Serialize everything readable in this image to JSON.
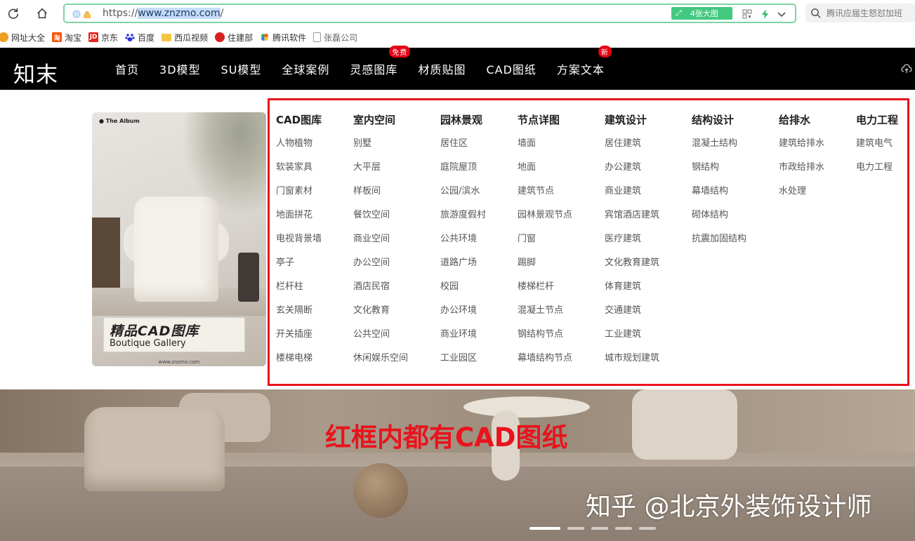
{
  "browser": {
    "url_prefix": "https://",
    "url_host": "www.znzmo.com",
    "url_suffix": "/",
    "bigimg_label": "4张大图",
    "search_placeholder": "腾讯应届生怒怼加班"
  },
  "bookmarks": [
    {
      "label": "网址大全",
      "icon": "globe-icon",
      "color": "#f0a020"
    },
    {
      "label": "淘宝",
      "icon": "taobao-icon",
      "color": "#ff5000"
    },
    {
      "label": "京东",
      "icon": "jd-icon",
      "color": "#e1251b"
    },
    {
      "label": "百度",
      "icon": "baidu-icon",
      "color": "#2932e1"
    },
    {
      "label": "西瓜视频",
      "icon": "folder-icon",
      "color": "#f5c542"
    },
    {
      "label": "住建部",
      "icon": "emblem-icon",
      "color": "#d82020"
    },
    {
      "label": "腾讯软件",
      "icon": "tencent-icon",
      "color": "#3cb44b"
    },
    {
      "label": "张磊公司",
      "icon": "document-icon",
      "color": "#999999"
    }
  ],
  "site": {
    "logo": "知末",
    "nav": [
      {
        "label": "首页"
      },
      {
        "label": "3D模型"
      },
      {
        "label": "SU模型"
      },
      {
        "label": "全球案例"
      },
      {
        "label": "灵感图库",
        "badge": "免费"
      },
      {
        "label": "材质贴图"
      },
      {
        "label": "CAD图纸"
      },
      {
        "label": "方案文本",
        "badge": "新"
      }
    ]
  },
  "album": {
    "tag": "● The Album",
    "title_cn": "精品CAD图库",
    "title_en": "Boutique Gallery",
    "url": "www.znzmo.com"
  },
  "categories": [
    {
      "title": "CAD图库",
      "items": [
        "人物植物",
        "软装家具",
        "门窗素材",
        "地面拼花",
        "电视背景墙",
        "亭子",
        "栏杆柱",
        "玄关隔断",
        "开关插座",
        "楼梯电梯"
      ]
    },
    {
      "title": "室内空间",
      "items": [
        "别墅",
        "大平层",
        "样板间",
        "餐饮空间",
        "商业空间",
        "办公空间",
        "酒店民宿",
        "文化教育",
        "公共空间",
        "休闲娱乐空间"
      ]
    },
    {
      "title": "园林景观",
      "items": [
        "居住区",
        "庭院屋顶",
        "公园/滨水",
        "旅游度假村",
        "公共环境",
        "道路广场",
        "校园",
        "办公环境",
        "商业环境",
        "工业园区"
      ]
    },
    {
      "title": "节点详图",
      "items": [
        "墙面",
        "地面",
        "建筑节点",
        "园林景观节点",
        "门窗",
        "踢脚",
        "楼梯栏杆",
        "混凝土节点",
        "钢结构节点",
        "幕墙结构节点"
      ]
    },
    {
      "title": "建筑设计",
      "items": [
        "居住建筑",
        "办公建筑",
        "商业建筑",
        "宾馆酒店建筑",
        "医疗建筑",
        "文化教育建筑",
        "体育建筑",
        "交通建筑",
        "工业建筑",
        "城市规划建筑"
      ]
    },
    {
      "title": "结构设计",
      "items": [
        "混凝土结构",
        "钢结构",
        "幕墙结构",
        "砌体结构",
        "抗震加固结构"
      ]
    },
    {
      "title": "给排水",
      "items": [
        "建筑给排水",
        "市政给排水",
        "水处理"
      ]
    },
    {
      "title": "电力工程",
      "items": [
        "建筑电气",
        "电力工程"
      ]
    }
  ],
  "banner": {
    "annotation": "红框内都有CAD图纸",
    "watermark": "知乎 @北京外装饰设计师",
    "slides": 5,
    "active_slide": 1
  },
  "colors": {
    "header_bg": "#000000",
    "annotation_red": "#e8141c",
    "badge_red": "#e60012",
    "url_border": "#7dd3a4"
  }
}
